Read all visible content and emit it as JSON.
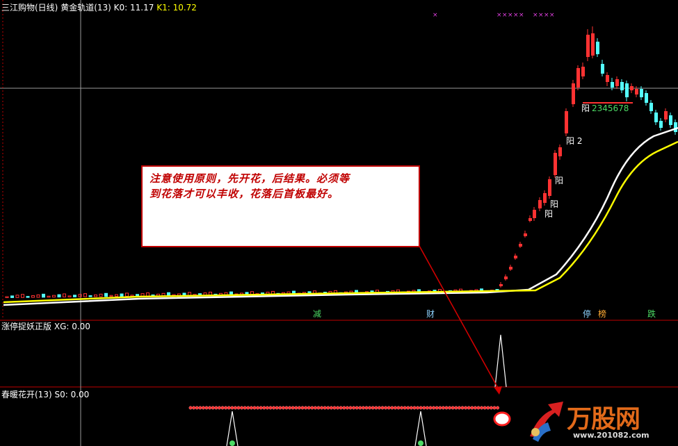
{
  "main_panel": {
    "indicator_name": "三江购物(日线)",
    "indicator_sub": "黄金轨道(13)",
    "k0_label": "K0: 11.17",
    "k1_label": "K1: 10.72"
  },
  "xg_panel": {
    "name": "涨停捉妖正版",
    "value_label": "XG: 0.00"
  },
  "s0_panel": {
    "name": "春暖花开(13)",
    "value_label": "S0: 0.00"
  },
  "annotation": {
    "line1": "注意使用原则，先开花，后结果。必须等",
    "line2": "到花落才可以丰收，花落后首板最好。"
  },
  "event_tags": [
    {
      "text": "减",
      "color": "#4cd964"
    },
    {
      "text": "财",
      "color": "#8fd3ff"
    },
    {
      "text": "停",
      "color": "#8fd3ff"
    },
    {
      "text": "榜",
      "color": "#ffaa33"
    },
    {
      "text": "跌",
      "color": "#4cd964"
    }
  ],
  "yang_labels": [
    {
      "text": "阳"
    },
    {
      "text": "阳"
    },
    {
      "text": "阳"
    },
    {
      "text": "阳 2"
    },
    {
      "text": "阳"
    }
  ],
  "streak_label": "2345678",
  "watermark": {
    "brand": "万股网",
    "url": "www.201082.com"
  },
  "colors": {
    "up": "#ff3232",
    "down": "#54ffff",
    "track_white": "#ffffff",
    "track_yellow": "#ffff00",
    "panel_border": "#c00000",
    "grid": "#8c8c8c"
  }
}
